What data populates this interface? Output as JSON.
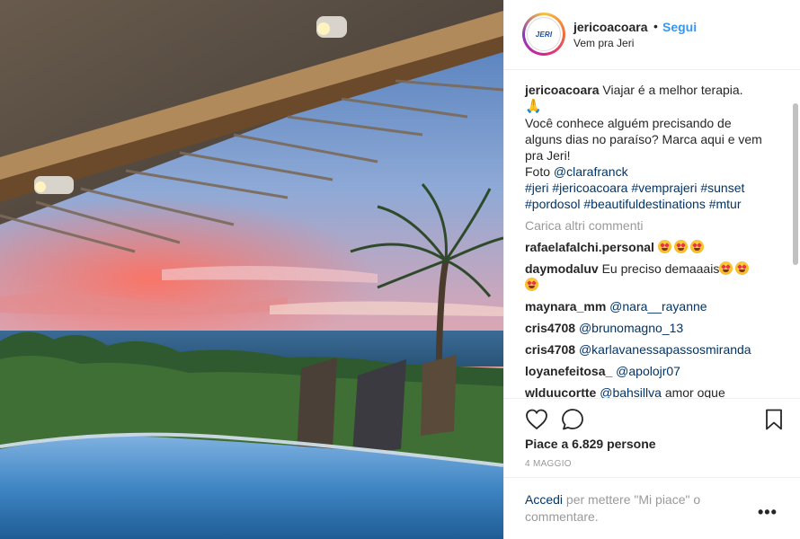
{
  "header": {
    "avatar_text": "JERI",
    "username": "jericoacoara",
    "dot": "•",
    "follow_label": "Segui",
    "location": "Vem pra Jeri"
  },
  "caption": {
    "username": "jericoacoara",
    "line1": "Viajar é a melhor terapia.",
    "emoji": "🙏",
    "line2": "Você conhece alguém precisando de alguns dias no paraíso? Marca aqui e vem pra Jeri!",
    "photo_prefix": "Foto",
    "photo_credit": "@clarafranck",
    "hashtags": [
      "#jeri",
      "#jericoacoara",
      "#vemprajeri",
      "#sunset",
      "#pordosol",
      "#beautifuldestinations",
      "#mtur"
    ]
  },
  "load_more": "Carica altri commenti",
  "comments": [
    {
      "user": "rafaelafalchi.personal",
      "text": "",
      "mention": "",
      "emojis": 3
    },
    {
      "user": "daymodaluv",
      "text": "Eu preciso demaaais",
      "mention": "",
      "emojis": 3
    },
    {
      "user": "maynara_mm",
      "text": "",
      "mention": "@nara__rayanne",
      "emojis": 0
    },
    {
      "user": "cris4708",
      "text": "",
      "mention": "@brunomagno_13",
      "emojis": 0
    },
    {
      "user": "cris4708",
      "text": "",
      "mention": "@karlavanessapassosmiranda",
      "emojis": 0
    },
    {
      "user": "loyanefeitosa_",
      "text": "",
      "mention": "@apolojr07",
      "emojis": 0
    },
    {
      "user": "wlduucortte",
      "text": "amor oque",
      "mention": "@bahsillva",
      "emojis": 0
    }
  ],
  "actions": {
    "like_icon": "heart-icon",
    "comment_icon": "comment-icon",
    "save_icon": "bookmark-icon"
  },
  "likes": "Piace a 6.829 persone",
  "date": "4 MAGGIO",
  "login": {
    "link": "Accedi",
    "text": " per mettere \"Mi piace\" o commentare."
  },
  "more_label": "•••",
  "colors": {
    "accent": "#3897f0",
    "link": "#003569",
    "muted": "#999999"
  }
}
